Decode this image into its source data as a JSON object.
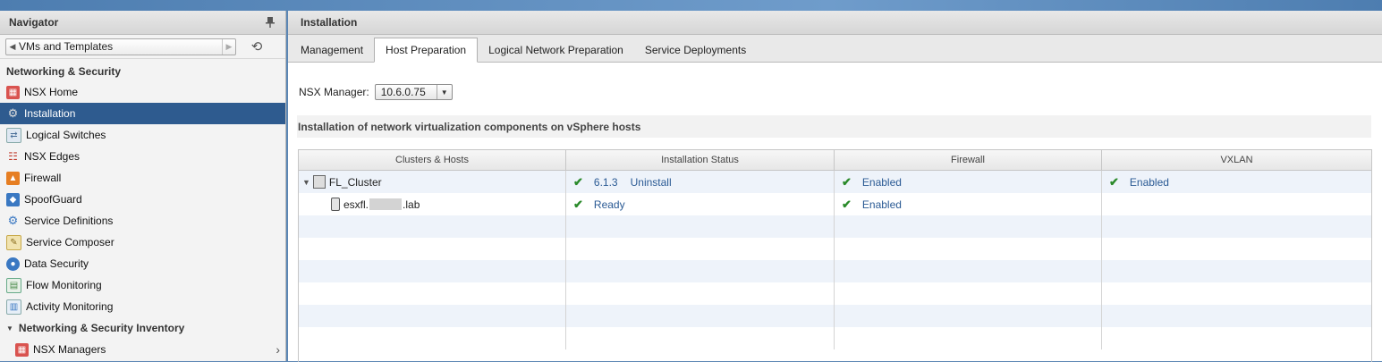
{
  "navigator": {
    "title": "Navigator",
    "breadcrumb": "VMs and Templates",
    "section_title": "Networking & Security",
    "items": [
      {
        "label": "NSX Home",
        "icon": "nsx-home-icon",
        "color": "#d9534f"
      },
      {
        "label": "Installation",
        "icon": "gear-icon",
        "color": "#8a8a8a",
        "selected": true
      },
      {
        "label": "Logical Switches",
        "icon": "logical-switch-icon",
        "color": "#6a8fb5"
      },
      {
        "label": "NSX Edges",
        "icon": "nsx-edge-icon",
        "color": "#c0392b"
      },
      {
        "label": "Firewall",
        "icon": "firewall-icon",
        "color": "#e67e22"
      },
      {
        "label": "SpoofGuard",
        "icon": "spoofguard-icon",
        "color": "#3a78c2"
      },
      {
        "label": "Service Definitions",
        "icon": "service-definitions-icon",
        "color": "#3a78c2"
      },
      {
        "label": "Service Composer",
        "icon": "service-composer-icon",
        "color": "#c8a94a"
      },
      {
        "label": "Data Security",
        "icon": "data-security-icon",
        "color": "#3a78c2"
      },
      {
        "label": "Flow Monitoring",
        "icon": "flow-monitoring-icon",
        "color": "#4a8a4a"
      },
      {
        "label": "Activity Monitoring",
        "icon": "activity-monitoring-icon",
        "color": "#3a78c2"
      }
    ],
    "inventory_title": "Networking & Security Inventory",
    "inventory_items": [
      {
        "label": "NSX Managers",
        "icon": "nsx-managers-icon"
      }
    ]
  },
  "main": {
    "title": "Installation",
    "tabs": [
      {
        "label": "Management",
        "active": false
      },
      {
        "label": "Host Preparation",
        "active": true
      },
      {
        "label": "Logical Network Preparation",
        "active": false
      },
      {
        "label": "Service Deployments",
        "active": false
      }
    ],
    "nsx_manager_label": "NSX Manager:",
    "nsx_manager_value": "10.6.0.75",
    "description": "Installation of network virtualization components on vSphere hosts",
    "columns": [
      "Clusters & Hosts",
      "Installation Status",
      "Firewall",
      "VXLAN"
    ],
    "rows": [
      {
        "name": "FL_Cluster",
        "type": "cluster",
        "install_version": "6.1.3",
        "install_action": "Uninstall",
        "firewall": "Enabled",
        "vxlan": "Enabled"
      },
      {
        "name_prefix": "esxfl.",
        "name_suffix": ".lab",
        "type": "host",
        "install_status": "Ready",
        "firewall": "Enabled",
        "vxlan": ""
      }
    ],
    "empty_rows": 6
  },
  "colors": {
    "selected_bg": "#2e5b8f",
    "link": "#2a5a94",
    "check": "#2a8a2a"
  }
}
